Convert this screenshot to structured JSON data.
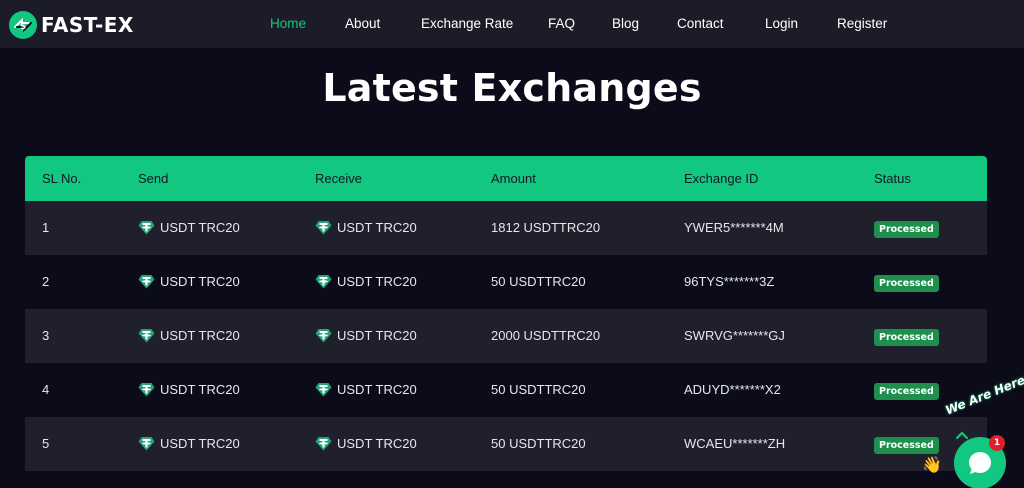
{
  "header": {
    "logo_text": "FAST-EX",
    "nav": [
      {
        "label": "Home",
        "active": true
      },
      {
        "label": "About"
      },
      {
        "label": "Exchange Rate"
      },
      {
        "label": "FAQ"
      },
      {
        "label": "Blog"
      },
      {
        "label": "Contact"
      },
      {
        "label": "Login"
      },
      {
        "label": "Register"
      }
    ]
  },
  "page": {
    "title": "Latest Exchanges"
  },
  "table": {
    "columns": [
      "SL No.",
      "Send",
      "Receive",
      "Amount",
      "Exchange ID",
      "Status"
    ],
    "rows": [
      {
        "sl": "1",
        "send": "USDT TRC20",
        "receive": "USDT TRC20",
        "amount": "1812 USDTTRC20",
        "exchange_id": "YWER5*******4M",
        "status": "Processed"
      },
      {
        "sl": "2",
        "send": "USDT TRC20",
        "receive": "USDT TRC20",
        "amount": "50 USDTTRC20",
        "exchange_id": "96TYS*******3Z",
        "status": "Processed"
      },
      {
        "sl": "3",
        "send": "USDT TRC20",
        "receive": "USDT TRC20",
        "amount": "2000 USDTTRC20",
        "exchange_id": "SWRVG*******GJ",
        "status": "Processed"
      },
      {
        "sl": "4",
        "send": "USDT TRC20",
        "receive": "USDT TRC20",
        "amount": "50 USDTTRC20",
        "exchange_id": "ADUYD*******X2",
        "status": "Processed"
      },
      {
        "sl": "5",
        "send": "USDT TRC20",
        "receive": "USDT TRC20",
        "amount": "50 USDTTRC20",
        "exchange_id": "WCAEU*******ZH",
        "status": "Processed"
      }
    ]
  },
  "chat": {
    "label": "We Are Here!",
    "unread_count": "1"
  },
  "colors": {
    "accent": "#12c77f",
    "background": "#0b0b1a",
    "header_bg": "#1c1c28",
    "row_alt": "#20202c",
    "badge": "#1f8f4e",
    "notification": "#e11d2e"
  },
  "icons": {
    "logo": "dollar-arrows-icon",
    "coin": "tether-icon",
    "chat": "chat-bubble-icon",
    "wave": "waving-hand-icon"
  }
}
